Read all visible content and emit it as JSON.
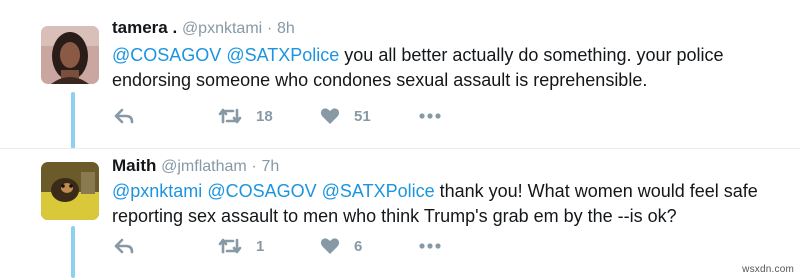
{
  "tweets": [
    {
      "name": "tamera .",
      "handle": "@pxnktami",
      "dot": "·",
      "time": "8h",
      "text_parts": [
        {
          "kind": "mention",
          "text": "@COSAGOV"
        },
        {
          "kind": "plain",
          "text": " "
        },
        {
          "kind": "mention",
          "text": "@SATXPolice"
        },
        {
          "kind": "plain",
          "text": " you all better actually do something. your police endorsing someone who condones sexual assault is reprehensible."
        }
      ],
      "retweets": "18",
      "likes": "51"
    },
    {
      "name": "Maith",
      "handle": "@jmflatham",
      "dot": "·",
      "time": "7h",
      "text_parts": [
        {
          "kind": "mention",
          "text": "@pxnktami"
        },
        {
          "kind": "plain",
          "text": " "
        },
        {
          "kind": "mention",
          "text": "@COSAGOV"
        },
        {
          "kind": "plain",
          "text": " "
        },
        {
          "kind": "mention",
          "text": "@SATXPolice"
        },
        {
          "kind": "plain",
          "text": " thank you!  What women would feel safe reporting sex assault to men who think Trump's grab em by the --is ok?"
        }
      ],
      "retweets": "1",
      "likes": "6"
    }
  ],
  "icons": {
    "reply": "reply-icon",
    "retweet": "retweet-icon",
    "like": "heart-icon",
    "more": "more-dots-icon"
  },
  "colors": {
    "mention": "#1b95e0",
    "muted": "#8899a6",
    "thread_line": "#8ed0ef"
  },
  "watermark": "wsxdn.com"
}
